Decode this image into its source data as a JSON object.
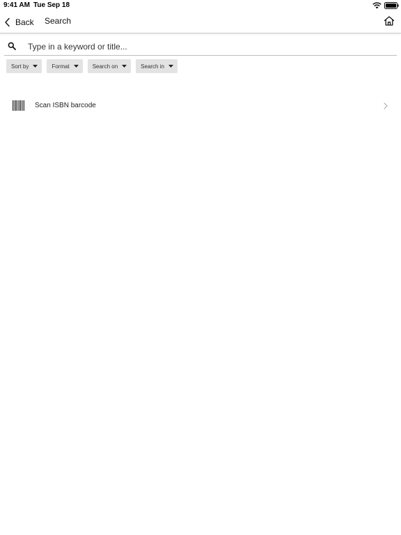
{
  "status_bar": {
    "time": "9:41 AM",
    "date": "Tue Sep 18",
    "icons": [
      "wifi-icon",
      "battery-icon"
    ]
  },
  "nav": {
    "back_label": "Back",
    "title": "Search",
    "home_icon": "home-icon"
  },
  "search": {
    "placeholder": "Type in a keyword or title...",
    "value": "",
    "icon": "search-icon"
  },
  "filters": [
    {
      "label": "Sort by"
    },
    {
      "label": "Format"
    },
    {
      "label": "Search on"
    },
    {
      "label": "Search in"
    }
  ],
  "scan": {
    "label": "Scan ISBN barcode",
    "icon": "barcode-icon"
  }
}
